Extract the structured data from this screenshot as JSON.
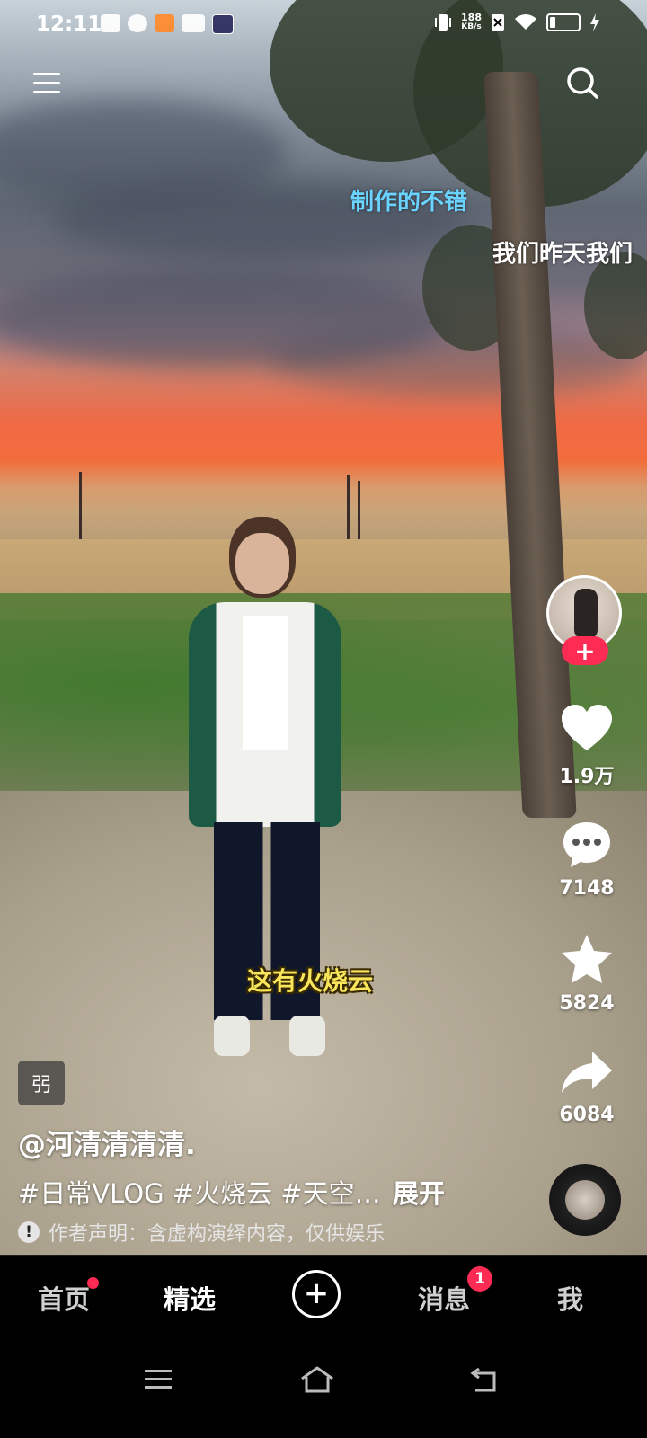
{
  "status_bar": {
    "time": "12:11",
    "net_speed_value": "188",
    "net_speed_unit": "KB/s",
    "icons": [
      "notification-icon",
      "app-icon",
      "app-icon",
      "vivo-icon",
      "app-icon",
      "vibrate-icon",
      "no-sim-icon",
      "wifi-icon",
      "battery-icon",
      "charging-icon"
    ]
  },
  "top_bar": {
    "menu_icon": "menu-icon",
    "search_icon": "search-icon"
  },
  "danmaku": [
    {
      "text": "制作的不错",
      "color": "#6ad3ff"
    },
    {
      "text": "我们昨天我们",
      "color": "#ffffff"
    }
  ],
  "video_caption": "这有火烧云",
  "side_actions": {
    "like_count": "1.9万",
    "comment_count": "7148",
    "favorite_count": "5824",
    "share_count": "6084",
    "follow_label": "+"
  },
  "info": {
    "tag_chip": "弜",
    "author": "@河清清清清.",
    "description": "#日常VLOG #火烧云 #天空…",
    "expand_label": "展开",
    "disclaimer": "作者声明：含虚构演绎内容，仅供娱乐"
  },
  "tab_bar": {
    "tabs": [
      {
        "label": "首页",
        "active": false,
        "dot": true
      },
      {
        "label": "精选",
        "active": true,
        "dot": false
      },
      {
        "label": "消息",
        "active": false,
        "badge": "1"
      },
      {
        "label": "我",
        "active": false
      }
    ],
    "create_label": "+"
  },
  "colors": {
    "accent": "#fe2c55",
    "background": "#000000"
  }
}
